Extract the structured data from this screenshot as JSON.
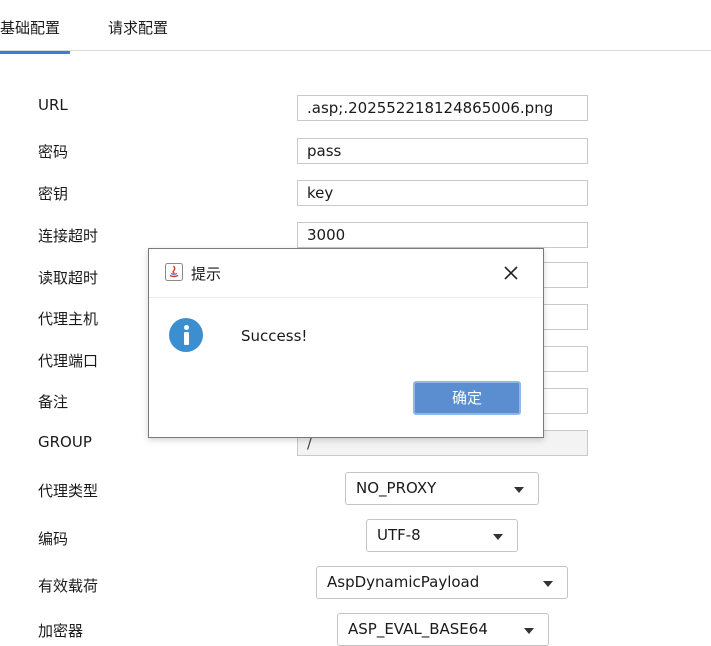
{
  "tabs": [
    {
      "label": "基础配置",
      "active": true
    },
    {
      "label": "请求配置",
      "active": false
    }
  ],
  "form": {
    "url_label": "URL",
    "url_value": ".asp;.202552218124865006.png",
    "password_label": "密码",
    "password_value": "pass",
    "key_label": "密钥",
    "key_value": "key",
    "connect_timeout_label": "连接超时",
    "connect_timeout_value": "3000",
    "read_timeout_label": "读取超时",
    "proxy_host_label": "代理主机",
    "proxy_port_label": "代理端口",
    "remark_label": "备注",
    "group_label": "GROUP",
    "group_value": "/",
    "proxy_type_label": "代理类型",
    "proxy_type_value": "NO_PROXY",
    "encoding_label": "编码",
    "encoding_value": "UTF-8",
    "payload_label": "有效载荷",
    "payload_value": "AspDynamicPayload",
    "cryption_label": "加密器",
    "cryption_value": "ASP_EVAL_BASE64"
  },
  "dialog": {
    "title": "提示",
    "message": "Success!",
    "ok_label": "确定"
  },
  "colors": {
    "accent": "#3d7dd8",
    "info_icon": "#3b8fd1",
    "ok_button": "#5a8ed1"
  },
  "icons": {
    "dialog_app": "java-icon",
    "dialog_close": "close-icon",
    "message": "info-icon",
    "combo_arrow": "chevron-down-icon"
  }
}
